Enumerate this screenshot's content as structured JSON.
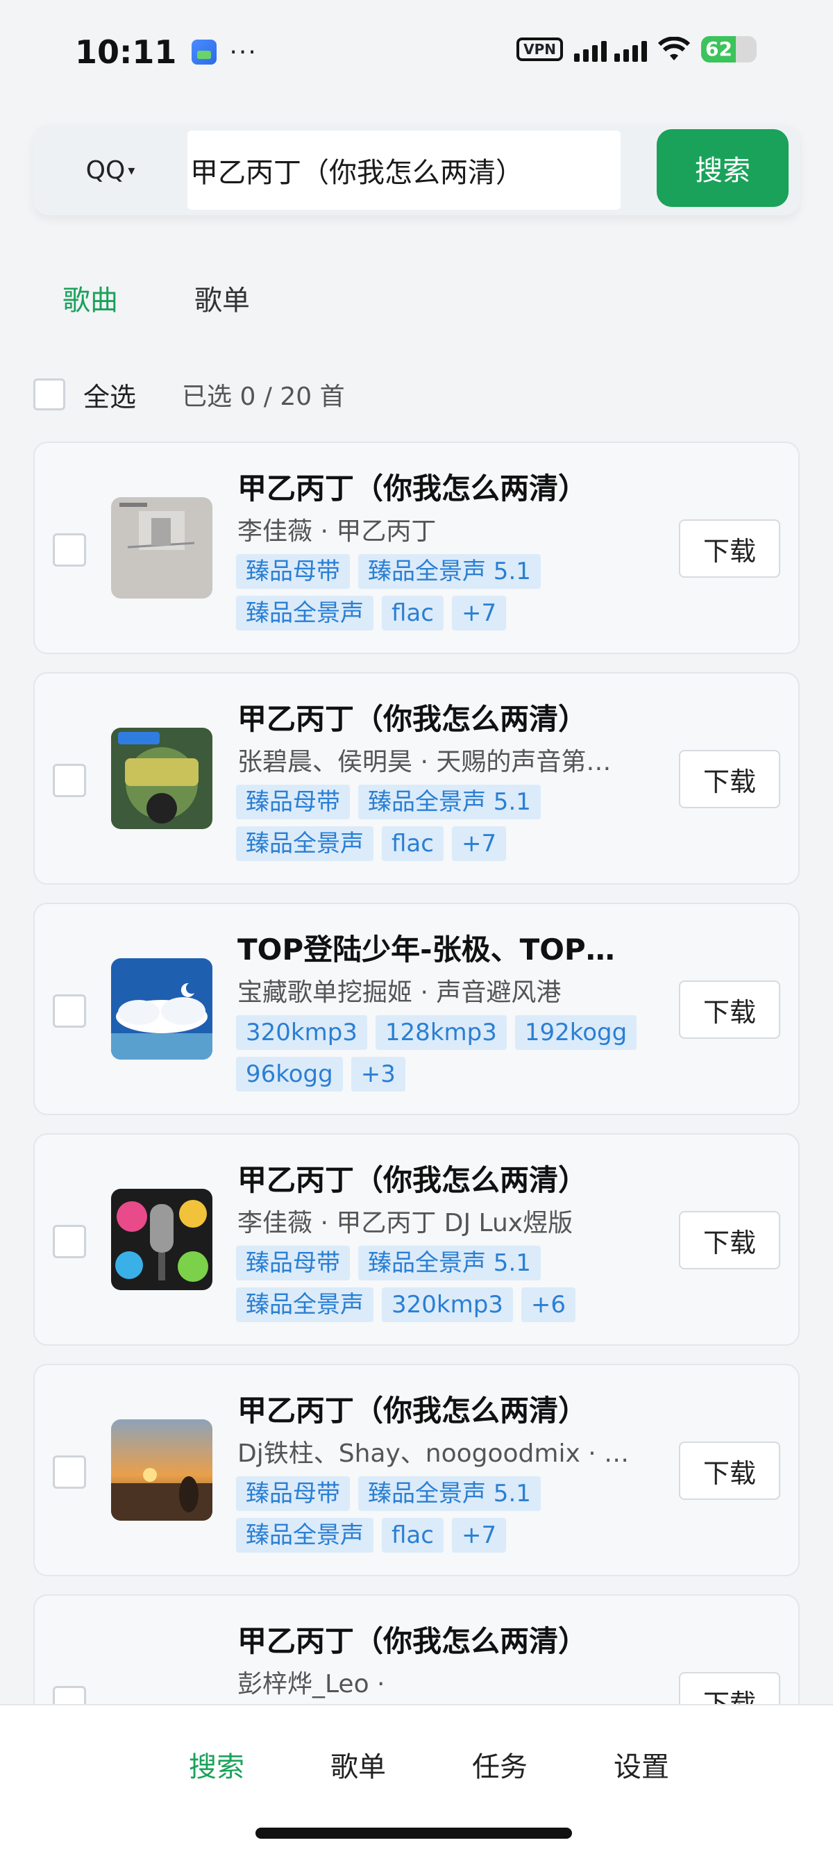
{
  "status_bar": {
    "time": "10:11",
    "dots": "···",
    "vpn": "VPN",
    "battery": "62"
  },
  "search": {
    "source": "QQ",
    "query": "甲乙丙丁（你我怎么两清）",
    "button": "搜索"
  },
  "tabs": [
    {
      "label": "歌曲",
      "active": true
    },
    {
      "label": "歌单",
      "active": false
    }
  ],
  "selection": {
    "select_all": "全选",
    "count": "已选 0 / 20 首"
  },
  "songs": [
    {
      "title": "甲乙丙丁（你我怎么两清）",
      "subtitle": "李佳薇 · 甲乙丙丁",
      "tags": [
        "臻品母带",
        "臻品全景声 5.1",
        "臻品全景声",
        "flac",
        "+7"
      ],
      "download": "下载"
    },
    {
      "title": "甲乙丙丁（你我怎么两清）",
      "subtitle": "张碧晨、侯明昊 · 天赐的声音第…",
      "tags": [
        "臻品母带",
        "臻品全景声 5.1",
        "臻品全景声",
        "flac",
        "+7"
      ],
      "download": "下载"
    },
    {
      "title": "TOP登陆少年-张极、TOP…",
      "subtitle": "宝藏歌单挖掘姬 · 声音避风港",
      "tags": [
        "320kmp3",
        "128kmp3",
        "192kogg",
        "96kogg",
        "+3"
      ],
      "download": "下载"
    },
    {
      "title": "甲乙丙丁（你我怎么两清）",
      "subtitle": "李佳薇 · 甲乙丙丁 DJ Lux煜版",
      "tags": [
        "臻品母带",
        "臻品全景声 5.1",
        "臻品全景声",
        "320kmp3",
        "+6"
      ],
      "download": "下载"
    },
    {
      "title": "甲乙丙丁（你我怎么两清）",
      "subtitle": "Dj铁柱、Shay、noogoodmix · …",
      "tags": [
        "臻品母带",
        "臻品全景声 5.1",
        "臻品全景声",
        "flac",
        "+7"
      ],
      "download": "下载"
    },
    {
      "title": "甲乙丙丁（你我怎么两清）",
      "subtitle": "彭梓烨_Leo ·",
      "tags": [],
      "download": "下载"
    }
  ],
  "nav": [
    {
      "label": "搜索",
      "active": true
    },
    {
      "label": "歌单",
      "active": false
    },
    {
      "label": "任务",
      "active": false
    },
    {
      "label": "设置",
      "active": false
    }
  ],
  "colors": {
    "accent": "#1aa25a",
    "tag_bg": "#dcebf9",
    "tag_text": "#2a7fd4"
  },
  "icons": {
    "cover_1": "album-cover-art",
    "cover_2": "album-cover-art",
    "cover_3": "album-cover-art",
    "cover_4": "album-cover-art",
    "cover_5": "album-cover-art"
  }
}
